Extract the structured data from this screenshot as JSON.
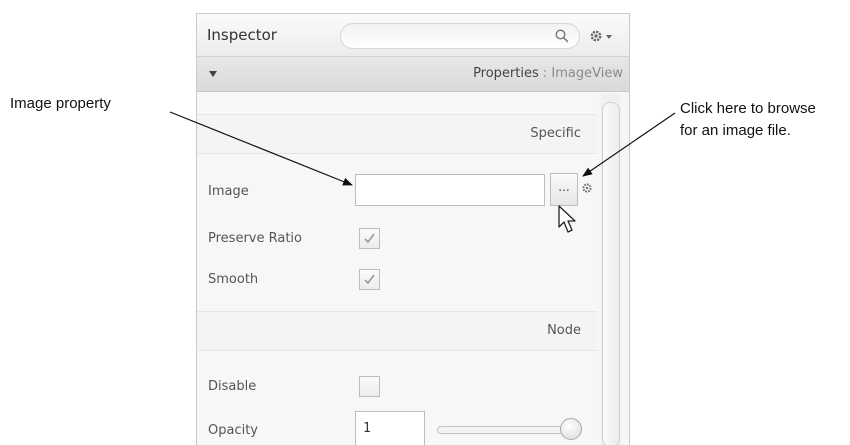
{
  "annotations": {
    "image_property": "Image property",
    "browse_line1": "Click here to browse",
    "browse_line2": "for an image file."
  },
  "inspector": {
    "title": "Inspector",
    "search": {
      "value": "",
      "icon": "search-icon"
    },
    "properties_label": "Properties",
    "properties_separator": " : ",
    "properties_target": "ImageView",
    "sections": {
      "specific": "Specific",
      "node": "Node"
    },
    "properties": {
      "image": {
        "label": "Image",
        "value": "",
        "browse_label": "..."
      },
      "preserve_ratio": {
        "label": "Preserve Ratio",
        "checked": true
      },
      "smooth": {
        "label": "Smooth",
        "checked": true
      },
      "disable": {
        "label": "Disable",
        "checked": false
      },
      "opacity": {
        "label": "Opacity",
        "value": "1",
        "slider_level": 1.0
      }
    }
  },
  "colors": {
    "panel_bg": "#f6f6f6",
    "titlebar_bg": "#ececec",
    "subbar_bg": "#dadada",
    "arrow": "#111111",
    "check": "#9a9a9a"
  }
}
